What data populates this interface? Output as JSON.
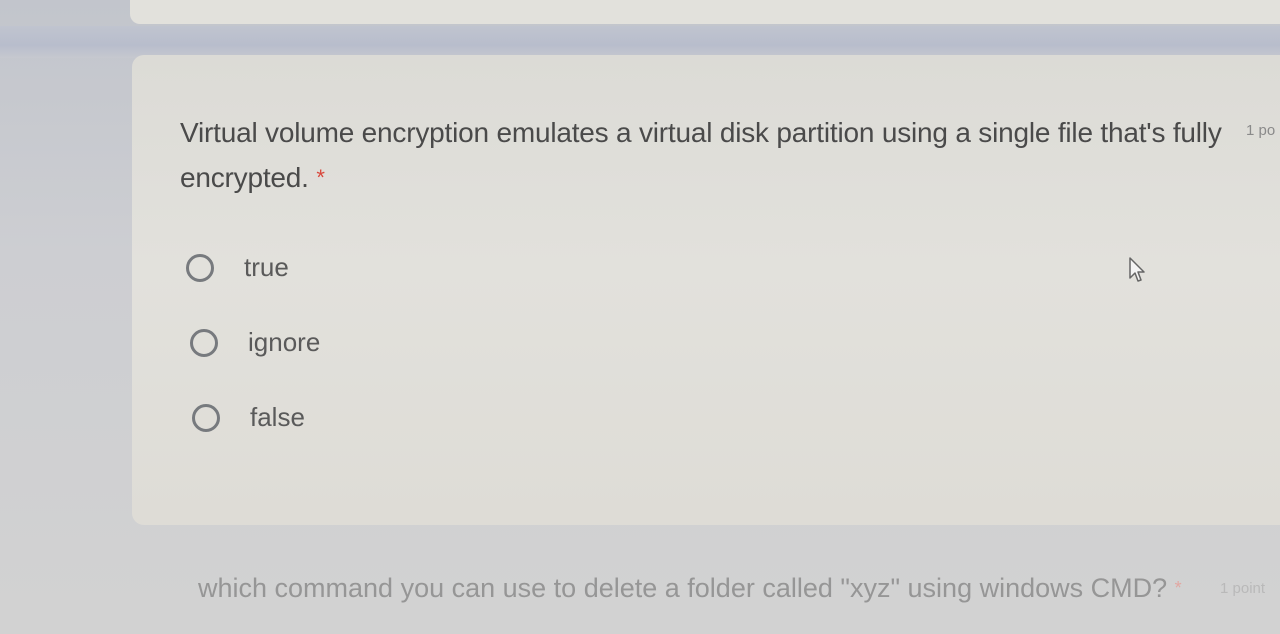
{
  "question1": {
    "text": "Virtual volume encryption emulates a virtual disk partition using a single file that's fully encrypted.",
    "required_mark": "*",
    "points": "1 po",
    "options": [
      {
        "label": "true"
      },
      {
        "label": "ignore"
      },
      {
        "label": "false"
      }
    ]
  },
  "question2": {
    "text": "which command you can use to delete a folder called \"xyz\" using windows CMD?",
    "required_mark": "*",
    "points": "1 point"
  },
  "icons": {
    "radio": "radio-unselected-icon",
    "cursor": "mouse-pointer-icon"
  },
  "colors": {
    "required": "#d9473c",
    "text": "#4a4a4a"
  }
}
